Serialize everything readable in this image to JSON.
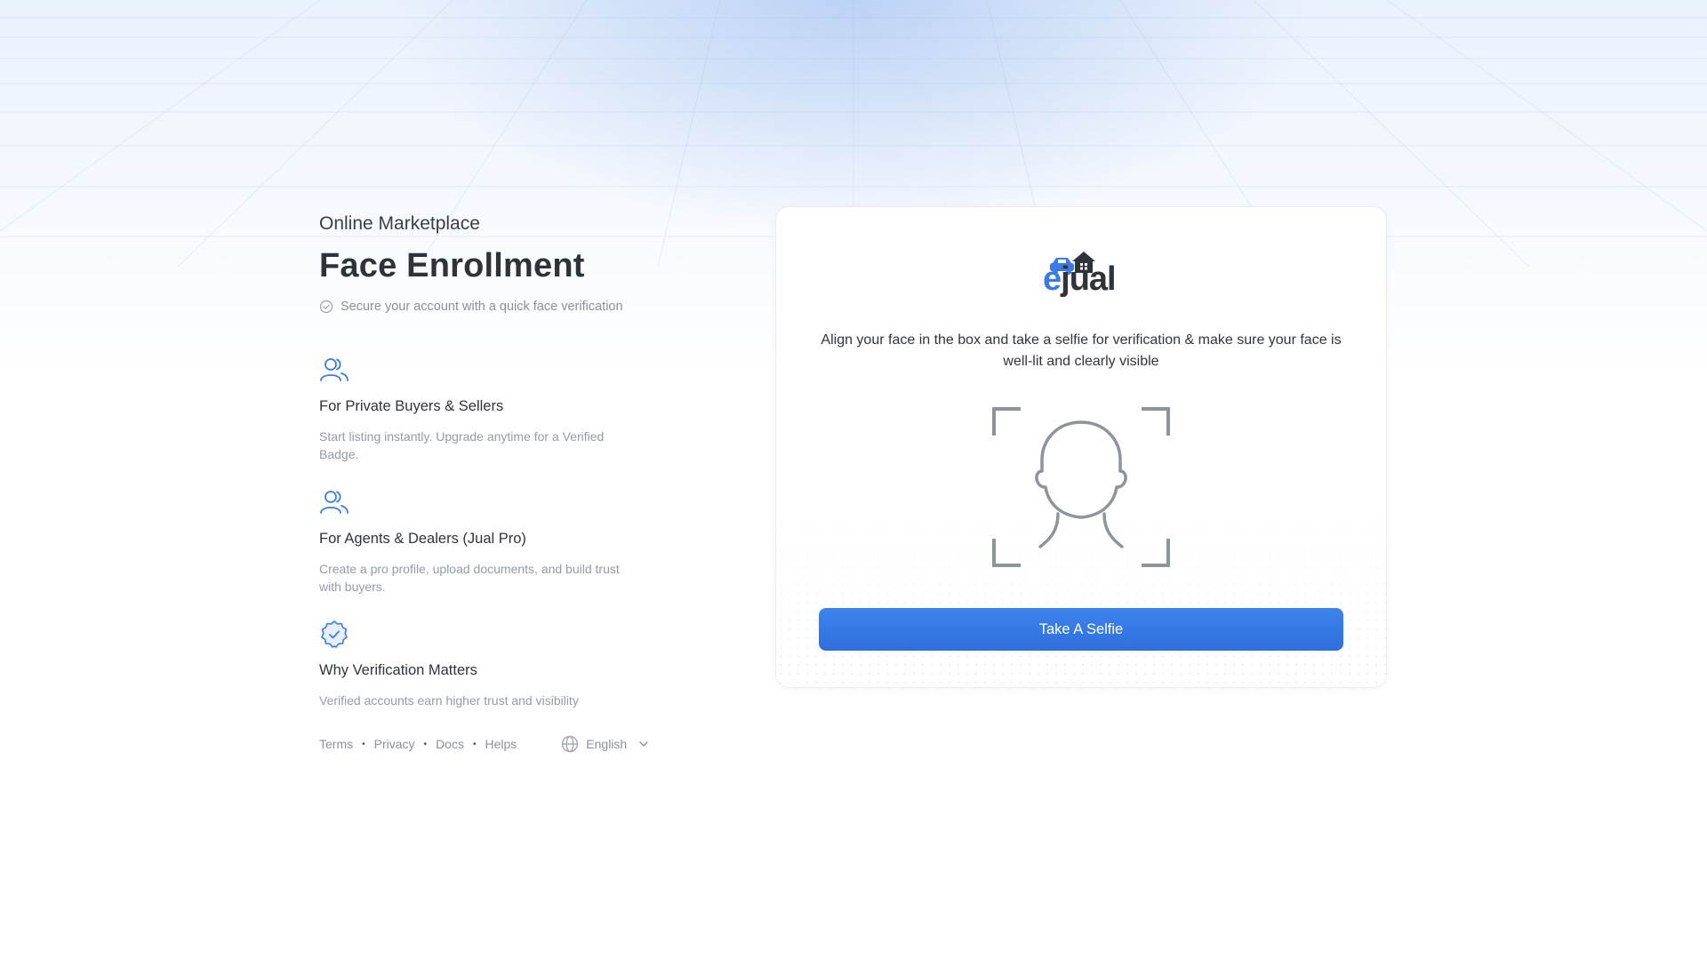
{
  "header": {
    "eyebrow": "Online Marketplace",
    "title": "Face Enrollment",
    "subtitle": "Secure your account with a quick face verification"
  },
  "features": [
    {
      "icon": "users-icon",
      "title": "For Private Buyers & Sellers",
      "description": "Start listing instantly. Upgrade anytime for a Verified Badge."
    },
    {
      "icon": "users-icon",
      "title": "For Agents & Dealers (Jual Pro)",
      "description": "Create a pro profile, upload documents, and build trust with buyers."
    },
    {
      "icon": "verified-badge-icon",
      "title": "Why Verification Matters",
      "description": "Verified accounts earn higher trust and visibility"
    }
  ],
  "footer": {
    "links": [
      "Terms",
      "Privacy",
      "Docs",
      "Helps"
    ],
    "language": "English"
  },
  "card": {
    "logo": {
      "e": "e",
      "rest": "jual"
    },
    "instruction": "Align your face in the box and take a selfie for verification & make sure your face is well-lit and clearly visible",
    "button_label": "Take A Selfie"
  },
  "colors": {
    "accent": "#3a7be8",
    "button": "#2f6fdc",
    "text": "#2e3239",
    "muted": "#959ba4"
  }
}
